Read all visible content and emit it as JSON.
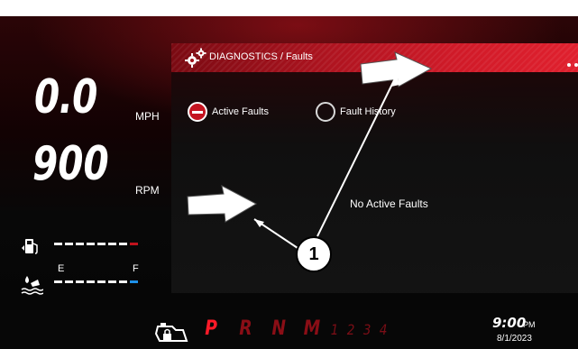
{
  "speed": {
    "value": "0.0",
    "unit": "MPH"
  },
  "rpm": {
    "value": "900",
    "unit": "RPM"
  },
  "fuel_gauge": {
    "empty_label": "E",
    "full_label": "F",
    "icon": "fuel-pump-icon"
  },
  "water_gauge": {
    "icon": "water-level-icon"
  },
  "header": {
    "title": "DIAGNOSTICS / Faults",
    "icon": "gears-icon"
  },
  "tabs": [
    {
      "label": "Active Faults",
      "selected": true
    },
    {
      "label": "Fault History",
      "selected": false
    }
  ],
  "message": "No Active Faults",
  "gears": {
    "letters": [
      "P",
      "R",
      "N",
      "M"
    ],
    "active": "P",
    "numbers": [
      "1",
      "2",
      "3",
      "4"
    ],
    "status_icon": "engine-lock-icon"
  },
  "clock": {
    "time": "9:00",
    "ampm": "PM",
    "date": "8/1/2023"
  },
  "annotation": {
    "callout_number": "1"
  },
  "colors": {
    "accent_red": "#c41420",
    "water_blue": "#1e90e8"
  }
}
